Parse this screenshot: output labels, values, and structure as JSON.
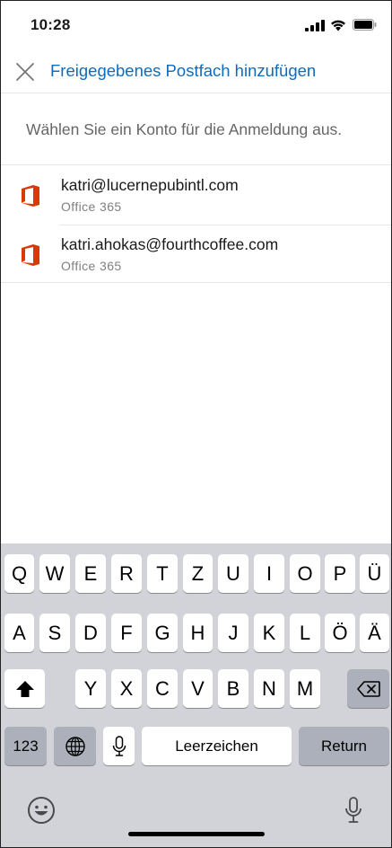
{
  "status_bar": {
    "time": "10:28"
  },
  "header": {
    "title": "Freigegebenes Postfach hinzufügen"
  },
  "subtitle": "Wählen Sie ein Konto für die Anmeldung aus.",
  "accounts": [
    {
      "email": "katri@lucernepubintl.com",
      "type": "Office 365"
    },
    {
      "email": "katri.ahokas@fourthcoffee.com",
      "type": "Office 365"
    }
  ],
  "keyboard": {
    "row1": [
      "Q",
      "W",
      "E",
      "R",
      "T",
      "Z",
      "U",
      "I",
      "O",
      "P",
      "Ü"
    ],
    "row2": [
      "A",
      "S",
      "D",
      "F",
      "G",
      "H",
      "J",
      "K",
      "L",
      "Ö",
      "Ä"
    ],
    "row3": [
      "Y",
      "X",
      "C",
      "V",
      "B",
      "N",
      "M"
    ],
    "numbers_label": "123",
    "space_label": "Leerzeichen",
    "return_label": "Return"
  },
  "colors": {
    "accent": "#0f6cbd",
    "office_red": "#d83b01",
    "keyboard_bg": "#d1d3d9"
  }
}
